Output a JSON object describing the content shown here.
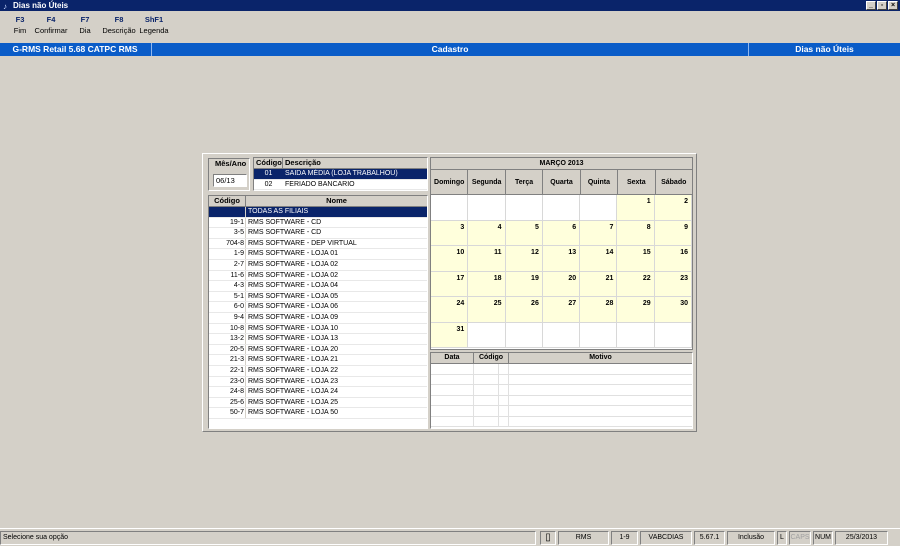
{
  "window": {
    "title": "Dias não Úteis"
  },
  "toolbar": [
    {
      "key": "F3",
      "label": "Fim"
    },
    {
      "key": "F4",
      "label": "Confirmar"
    },
    {
      "key": "F7",
      "label": "Dia"
    },
    {
      "key": "F8",
      "label": "Descrição"
    },
    {
      "key": "ShF1",
      "label": "Legenda"
    }
  ],
  "infobar": {
    "app": "G-RMS Retail 5.68 CATPC RMS",
    "module": "Cadastro",
    "screen": "Dias não Úteis"
  },
  "mes_ano": {
    "label": "Mês/Ano",
    "value": "06/13"
  },
  "legend": {
    "headers": [
      "Código",
      "Descrição"
    ],
    "rows": [
      {
        "code": "01",
        "desc": "SAIDA MÉDIA (LOJA TRABALHOU)"
      },
      {
        "code": "02",
        "desc": "FERIADO BANCARIO"
      }
    ]
  },
  "filiais": {
    "headers": [
      "Código",
      "Nome"
    ],
    "rows": [
      {
        "code": "",
        "name": "TODAS AS FILIAIS"
      },
      {
        "code": "19-1",
        "name": "RMS SOFTWARE -  CD"
      },
      {
        "code": "3-5",
        "name": "RMS SOFTWARE - CD"
      },
      {
        "code": "704-8",
        "name": "RMS SOFTWARE - DEP VIRTUAL"
      },
      {
        "code": "1-9",
        "name": "RMS SOFTWARE - LOJA 01"
      },
      {
        "code": "2-7",
        "name": "RMS SOFTWARE - LOJA 02"
      },
      {
        "code": "11-6",
        "name": "RMS SOFTWARE - LOJA 02"
      },
      {
        "code": "4-3",
        "name": "RMS SOFTWARE - LOJA 04"
      },
      {
        "code": "5-1",
        "name": "RMS SOFTWARE - LOJA 05"
      },
      {
        "code": "6-0",
        "name": "RMS SOFTWARE - LOJA 06"
      },
      {
        "code": "9-4",
        "name": "RMS SOFTWARE - LOJA 09"
      },
      {
        "code": "10-8",
        "name": "RMS SOFTWARE - LOJA 10"
      },
      {
        "code": "13-2",
        "name": "RMS SOFTWARE - LOJA 13"
      },
      {
        "code": "20-5",
        "name": "RMS SOFTWARE - LOJA 20"
      },
      {
        "code": "21-3",
        "name": "RMS SOFTWARE - LOJA 21"
      },
      {
        "code": "22-1",
        "name": "RMS SOFTWARE - LOJA 22"
      },
      {
        "code": "23-0",
        "name": "RMS SOFTWARE - LOJA 23"
      },
      {
        "code": "24-8",
        "name": "RMS SOFTWARE - LOJA 24"
      },
      {
        "code": "25-6",
        "name": "RMS SOFTWARE - LOJA 25"
      },
      {
        "code": "50-7",
        "name": "RMS SOFTWARE - LOJA 50"
      }
    ]
  },
  "calendar": {
    "title": "MARÇO 2013",
    "weekdays": [
      "Domingo",
      "Segunda",
      "Terça",
      "Quarta",
      "Quinta",
      "Sexta",
      "Sábado"
    ],
    "cells": [
      "",
      "",
      "",
      "",
      "",
      "1",
      "2",
      "3",
      "4",
      "5",
      "6",
      "7",
      "8",
      "9",
      "10",
      "11",
      "12",
      "13",
      "14",
      "15",
      "16",
      "17",
      "18",
      "19",
      "20",
      "21",
      "22",
      "23",
      "24",
      "25",
      "26",
      "27",
      "28",
      "29",
      "30",
      "31",
      "",
      "",
      "",
      "",
      "",
      ""
    ],
    "colors": {
      "in_month": "#ffffdc",
      "out_month": "#ffffff"
    }
  },
  "motivo": {
    "headers": [
      "Data",
      "Código",
      "Motivo"
    ]
  },
  "status": {
    "message": "Selecione sua opção",
    "user": "RMS",
    "filial": "1-9",
    "program": "VABCDIAS",
    "version": "5.67.1",
    "mode": "Inclusão",
    "l": "L",
    "caps": "CAPS",
    "num": "NUM",
    "date": "25/3/2013"
  },
  "colors": {
    "titlebar": "#0a246a",
    "infobar": "#0a5cc8",
    "selection": "#0a246a"
  }
}
